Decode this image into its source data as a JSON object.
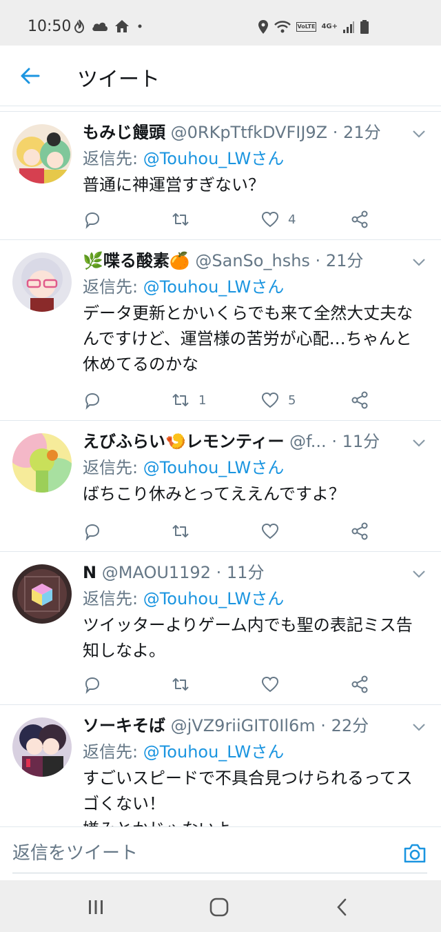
{
  "status_bar": {
    "time": "10:50",
    "network": "4G+",
    "volte": "VoLTE"
  },
  "header": {
    "title": "ツイート"
  },
  "tweets": [
    {
      "name": "もみじ饅頭",
      "handle": "@0RKpTtfkDVFIJ9Z",
      "sep": "·",
      "time": "21分",
      "reply_label": "返信先: ",
      "reply_to": "@Touhou_LWさん",
      "text": "普通に神運営すぎない？",
      "retweets": "",
      "likes": "4"
    },
    {
      "name": "🌿喋る酸素🍊",
      "handle": "@SanSo_hshs",
      "sep": "·",
      "time": "21分",
      "reply_label": "返信先: ",
      "reply_to": "@Touhou_LWさん",
      "text": "データ更新とかいくらでも来て全然大丈夫なんですけど、運営様の苦労が心配…ちゃんと休めてるのかな",
      "retweets": "1",
      "likes": "5"
    },
    {
      "name": "えびふらい🍤レモンティー",
      "handle": "@f...",
      "sep": "·",
      "time": "11分",
      "reply_label": "返信先: ",
      "reply_to": "@Touhou_LWさん",
      "text": "ばちこり休みとってええんですよ？",
      "retweets": "",
      "likes": ""
    },
    {
      "name": "N",
      "handle": "@MAOU1192",
      "sep": "·",
      "time": "11分",
      "reply_label": "返信先: ",
      "reply_to": "@Touhou_LWさん",
      "text": "ツイッターよりゲーム内でも聖の表記ミス告知しなよ。",
      "retweets": "",
      "likes": ""
    },
    {
      "name": "ソーキそば",
      "handle": "@jVZ9riiGIT0Il6m",
      "sep": "·",
      "time": "22分",
      "reply_label": "返信先: ",
      "reply_to": "@Touhou_LWさん",
      "text": "すごいスピードで不具合見つけられるってスゴくない！\n嫌みとかじゃないよ",
      "retweets": "",
      "likes": ""
    }
  ],
  "reply_bar": {
    "placeholder": "返信をツイート"
  },
  "colors": {
    "accent": "#1b95e0",
    "muted": "#657786",
    "text": "#14171a",
    "border": "#e1e8ed"
  },
  "icons": [
    "back-arrow-icon",
    "caret-down-icon",
    "reply-icon",
    "retweet-icon",
    "like-icon",
    "share-icon",
    "camera-icon",
    "recents-icon",
    "home-icon",
    "back-icon"
  ]
}
